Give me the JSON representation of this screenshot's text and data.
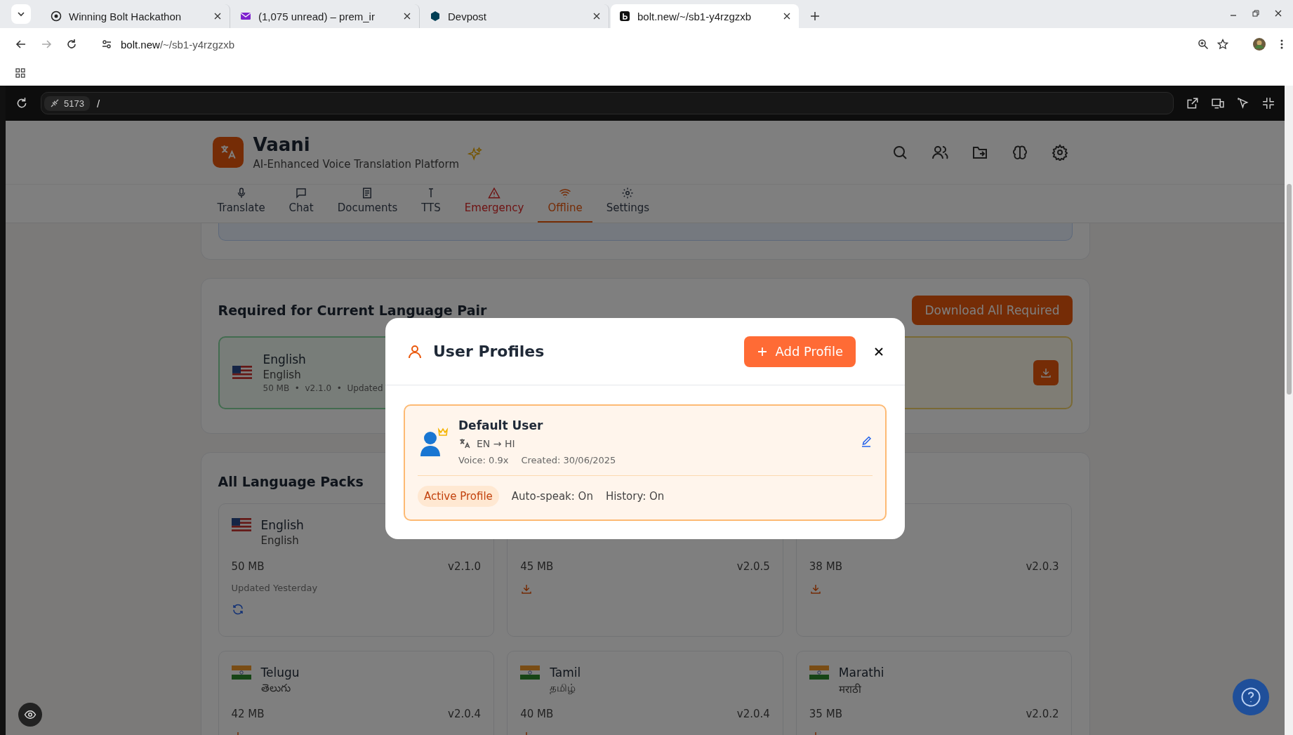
{
  "browser": {
    "tabs": [
      {
        "title": "Winning Bolt Hackathon",
        "kind": "globe",
        "selected": false
      },
      {
        "title": "(1,075 unread) – prem_ir",
        "kind": "mail",
        "selected": false
      },
      {
        "title": "Devpost",
        "kind": "devpost",
        "selected": false
      },
      {
        "title": "bolt.new/~/sb1-y4rzgzxb",
        "kind": "bolt",
        "selected": true
      }
    ],
    "url_host": "bolt.new",
    "url_path": "/~/sb1-y4rzgzxb"
  },
  "preview_bar": {
    "port": "5173",
    "path": "/"
  },
  "app": {
    "name": "Vaani",
    "tagline": "AI-Enhanced Voice Translation Platform",
    "nav": [
      {
        "label": "Translate",
        "kind": "mic",
        "selected": false
      },
      {
        "label": "Chat",
        "kind": "chat",
        "selected": false
      },
      {
        "label": "Documents",
        "kind": "doc",
        "selected": false
      },
      {
        "label": "TTS",
        "kind": "tts",
        "selected": false
      },
      {
        "label": "Emergency",
        "kind": "alert",
        "selected": false
      },
      {
        "label": "Offline",
        "kind": "wifi",
        "selected": true
      },
      {
        "label": "Settings",
        "kind": "gear",
        "selected": false
      }
    ],
    "required": {
      "title": "Required for Current Language Pair",
      "button": "Download All Required",
      "packs": [
        {
          "kind": "installed",
          "flag": {
            "kind": "us"
          },
          "name": "English",
          "native": "English",
          "meta": "50 MB  •  v2.1.0  •  Updated"
        },
        {
          "kind": "missing"
        }
      ]
    },
    "all_packs": {
      "title": "All Language Packs",
      "packs": [
        {
          "kind": "installed",
          "flag": {
            "kind": "us"
          },
          "name": "English",
          "native": "English",
          "size": "50 MB",
          "version": "v2.1.0",
          "note": "Updated Yesterday"
        },
        {
          "kind": "available",
          "size": "45 MB",
          "version": "v2.0.5"
        },
        {
          "kind": "available",
          "size": "38 MB",
          "version": "v2.0.3"
        },
        {
          "kind": "available",
          "flag": {
            "kind": "in"
          },
          "name": "Telugu",
          "native": "తెలుగు",
          "size": "42 MB",
          "version": "v2.0.4"
        },
        {
          "kind": "available",
          "flag": {
            "kind": "in"
          },
          "name": "Tamil",
          "native": "தமிழ்",
          "size": "40 MB",
          "version": "v2.0.4"
        },
        {
          "kind": "available",
          "flag": {
            "kind": "in"
          },
          "name": "Marathi",
          "native": "मराठी",
          "size": "35 MB",
          "version": "v2.0.2"
        }
      ]
    }
  },
  "modal": {
    "title": "User Profiles",
    "add_button": "Add Profile",
    "profiles": [
      {
        "name": "Default User",
        "languages": "EN → HI",
        "voice": "Voice: 0.9x",
        "created": "Created: 30/06/2025",
        "selected": true,
        "badge": "Active Profile",
        "auto_speak": "Auto-speak: On",
        "history": "History: On"
      }
    ]
  }
}
